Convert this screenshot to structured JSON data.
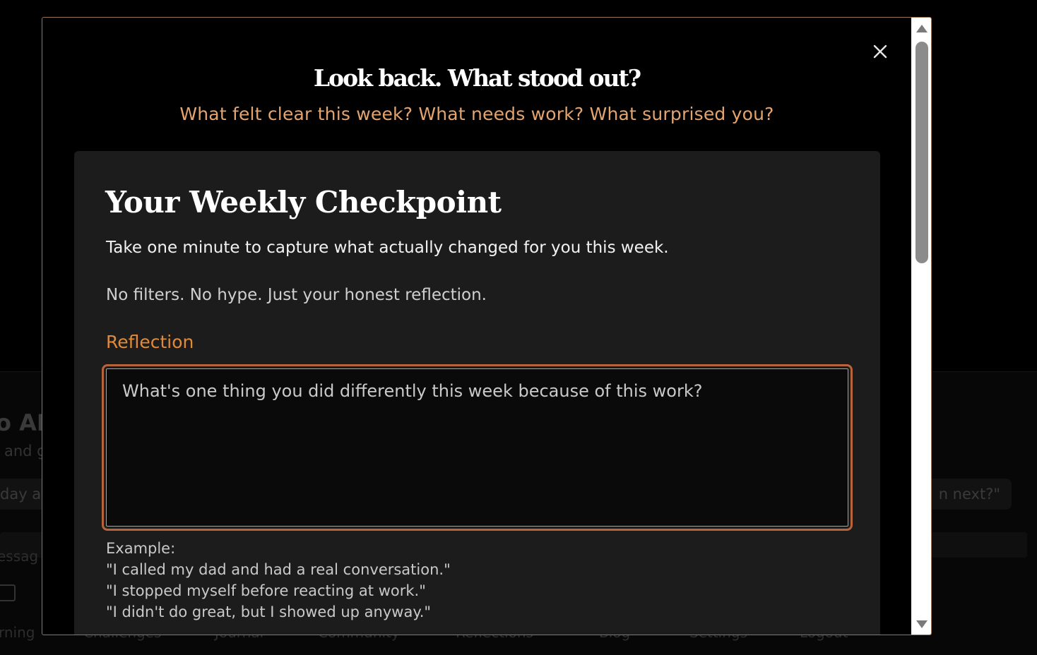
{
  "background": {
    "heading": "o AI",
    "subheading": "and g",
    "chip_left": "day a",
    "chip_right": "n next?\"",
    "input_placeholder": "essag",
    "nav": [
      "rning",
      "Challenges",
      "Journal",
      "Community",
      "Reflections",
      "Blog",
      "Settings",
      "Logout"
    ]
  },
  "modal": {
    "title": "Look back. What stood out?",
    "subtitle": "What felt clear this week? What needs work? What surprised you?",
    "close_icon": "close-icon"
  },
  "card": {
    "title": "Your Weekly Checkpoint",
    "intro": "Take one minute to capture what actually changed for you this week.",
    "note": "No filters. No hype. Just your honest reflection.",
    "field_label": "Reflection",
    "placeholder": "What's one thing you did differently this week because of this work?",
    "example_heading": "Example:",
    "examples": [
      "\"I called my dad and had a real conversation.\"",
      "\"I stopped myself before reacting at work.\"",
      "\"I didn't do great, but I showed up anyway.\""
    ]
  },
  "colors": {
    "accent_orange": "#e08a3b",
    "subtitle_peach": "#e3a46f",
    "textarea_border": "#b8643a",
    "card_bg": "#1c1c1c"
  }
}
